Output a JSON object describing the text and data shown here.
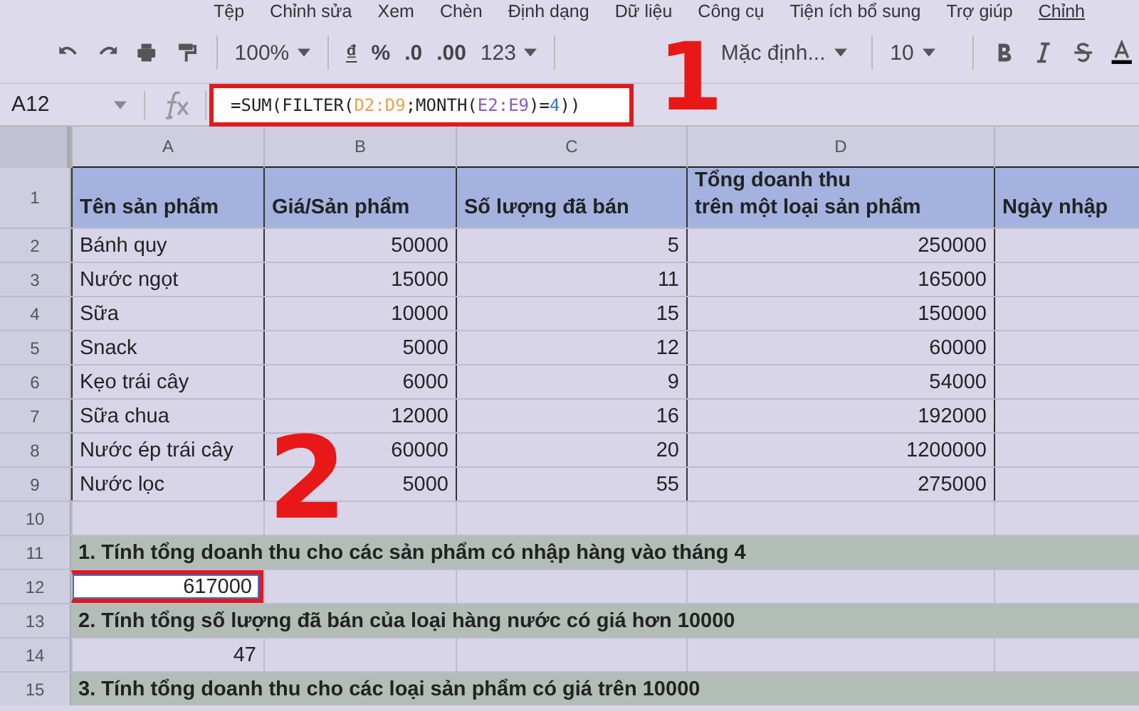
{
  "menu": [
    {
      "label": "Tệp",
      "kind": "menu"
    },
    {
      "label": "Chỉnh sửa",
      "kind": "menu"
    },
    {
      "label": "Xem",
      "kind": "menu"
    },
    {
      "label": "Chèn",
      "kind": "menu"
    },
    {
      "label": "Định dạng",
      "kind": "menu"
    },
    {
      "label": "Dữ liệu",
      "kind": "menu"
    },
    {
      "label": "Công cụ",
      "kind": "menu"
    },
    {
      "label": "Tiện ích bổ sung",
      "kind": "menu"
    },
    {
      "label": "Trợ giúp",
      "kind": "menu"
    },
    {
      "label": "Chỉnh",
      "kind": "link"
    }
  ],
  "toolbar": {
    "zoom": "100%",
    "currency": "₫",
    "percent": "%",
    "decrease_decimals": ".0",
    "increase_decimals": ".00",
    "number_format": "123",
    "font": "Mặc định...",
    "font_size": "10"
  },
  "formula_bar": {
    "cell_ref": "A12",
    "formula": [
      {
        "text": "=SUM(FILTER(",
        "color": "#222222"
      },
      {
        "text": "D2:D9",
        "color": "#e8a04e"
      },
      {
        "text": ";MONTH(",
        "color": "#222222"
      },
      {
        "text": "E2:E9",
        "color": "#8a5ab5"
      },
      {
        "text": ")=",
        "color": "#222222"
      },
      {
        "text": "4",
        "color": "#3a6fd8"
      },
      {
        "text": "))",
        "color": "#222222"
      }
    ]
  },
  "columns": [
    "A",
    "B",
    "C",
    "D"
  ],
  "rows": [
    {
      "number": "1",
      "kind": "header",
      "cells": [
        "Tên sản phẩm",
        "Giá/Sản phẩm",
        "Số lượng đã bán",
        "Tổng doanh thu\ntrên một loại sản phẩm",
        "Ngày nhập"
      ]
    },
    {
      "number": "2",
      "kind": "data",
      "cells": [
        "Bánh quy",
        "50000",
        "5",
        "250000"
      ]
    },
    {
      "number": "3",
      "kind": "data",
      "cells": [
        "Nước ngọt",
        "15000",
        "11",
        "165000"
      ]
    },
    {
      "number": "4",
      "kind": "data",
      "cells": [
        "Sữa",
        "10000",
        "15",
        "150000"
      ]
    },
    {
      "number": "5",
      "kind": "data",
      "cells": [
        "Snack",
        "5000",
        "12",
        "60000"
      ]
    },
    {
      "number": "6",
      "kind": "data",
      "cells": [
        "Kẹo trái cây",
        "6000",
        "9",
        "54000"
      ]
    },
    {
      "number": "7",
      "kind": "data",
      "cells": [
        "Sữa chua",
        "12000",
        "16",
        "192000"
      ]
    },
    {
      "number": "8",
      "kind": "data",
      "cells": [
        "Nước ép trái cây",
        "60000",
        "20",
        "1200000"
      ]
    },
    {
      "number": "9",
      "kind": "data",
      "cells": [
        "Nước lọc",
        "5000",
        "55",
        "275000"
      ]
    },
    {
      "number": "10",
      "kind": "blank",
      "cells": []
    },
    {
      "number": "11",
      "kind": "section",
      "cells": [
        "1. Tính tổng doanh thu cho các sản phẩm có nhập hàng vào tháng 4"
      ]
    },
    {
      "number": "12",
      "kind": "value",
      "selected": true,
      "cells": [
        "617000"
      ]
    },
    {
      "number": "13",
      "kind": "section",
      "cells": [
        "2. Tính tổng số lượng đã bán của loại hàng nước có giá hơn 10000"
      ]
    },
    {
      "number": "14",
      "kind": "value",
      "selected": false,
      "cells": [
        "47"
      ]
    },
    {
      "number": "15",
      "kind": "section",
      "cells": [
        "3. Tính tổng doanh thu cho các loại sản phẩm có giá trên 10000"
      ]
    }
  ],
  "annotations": [
    "1",
    "2"
  ]
}
